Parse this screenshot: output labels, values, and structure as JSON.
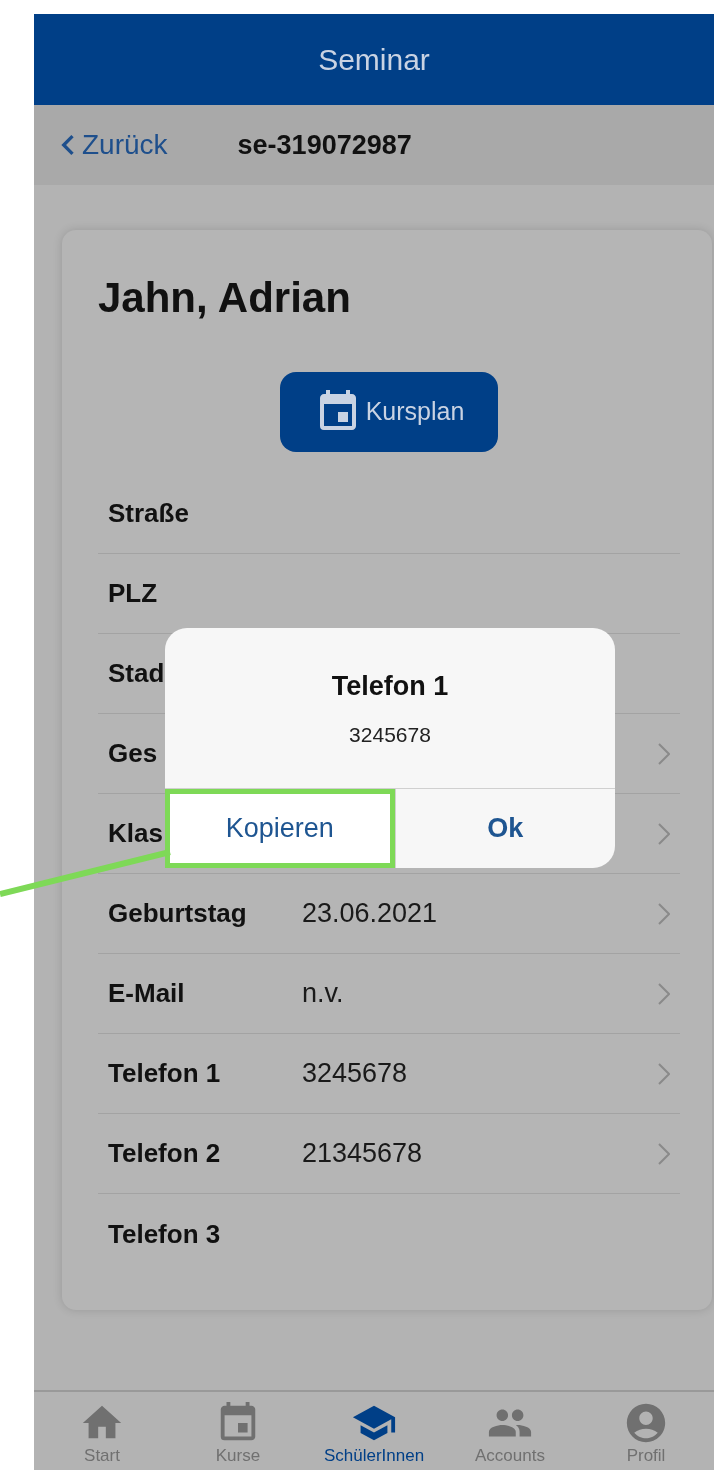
{
  "app_bar": {
    "title": "Seminar"
  },
  "nav_bar": {
    "back": "Zurück",
    "title": "se-319072987"
  },
  "student": {
    "name": "Jahn, Adrian",
    "schedule_button": "Kursplan"
  },
  "fields": [
    {
      "label": "Straße",
      "navigable": false
    },
    {
      "label": "PLZ",
      "navigable": false
    },
    {
      "label": "Stad",
      "navigable": false
    },
    {
      "label": "Ges",
      "navigable": true
    },
    {
      "label": "Klas",
      "navigable": true
    },
    {
      "label": "Geburtstag",
      "value": "23.06.2021",
      "navigable": true
    },
    {
      "label": "E-Mail",
      "value": "n.v.",
      "navigable": true
    },
    {
      "label": "Telefon 1",
      "value": "3245678",
      "navigable": true
    },
    {
      "label": "Telefon 2",
      "value": "21345678",
      "navigable": true
    },
    {
      "label": "Telefon 3",
      "navigable": false
    }
  ],
  "dialog": {
    "title": "Telefon 1",
    "message": "3245678",
    "buttons": [
      {
        "label": "Kopieren",
        "highlighted": true,
        "emphasized": false
      },
      {
        "label": "Ok",
        "highlighted": false,
        "emphasized": true
      }
    ]
  },
  "tab_bar": [
    {
      "label": "Start",
      "selected": false
    },
    {
      "label": "Kurse",
      "selected": false
    },
    {
      "label": "SchülerInnen",
      "selected": true
    },
    {
      "label": "Accounts",
      "selected": false
    },
    {
      "label": "Profil",
      "selected": false
    }
  ]
}
